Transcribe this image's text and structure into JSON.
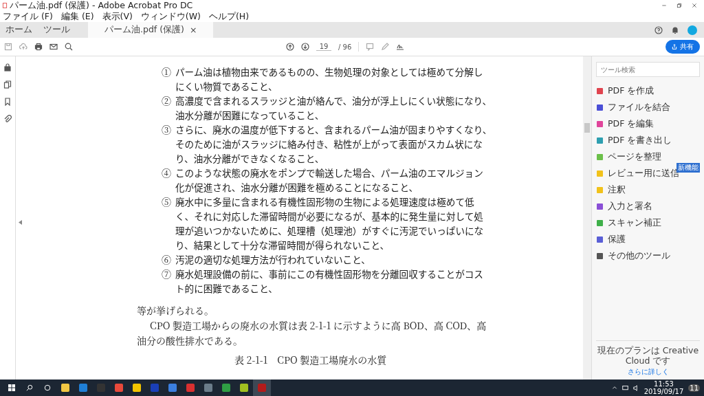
{
  "window": {
    "title": "パーム油.pdf (保護) - Adobe Acrobat Pro DC"
  },
  "menu": [
    "ファイル (F)",
    "編集 (E)",
    "表示(V)",
    "ウィンドウ(W)",
    "ヘルプ(H)"
  ],
  "tabs": [
    {
      "label": "ホーム",
      "selected": false
    },
    {
      "label": "ツール",
      "selected": false
    },
    {
      "label": "パーム油.pdf (保護)",
      "selected": true,
      "close": "×"
    }
  ],
  "toolbar": {
    "page": "19",
    "total": "/ 96",
    "share": "共有"
  },
  "document": {
    "items": [
      {
        "number": "①",
        "lines": [
          "パーム油は植物由来であるものの、生物処理の対象としては極めて分解し",
          "にくい物質であること、"
        ]
      },
      {
        "number": "②",
        "lines": [
          "高濃度で含まれるスラッジと油が絡んで、油分が浮上しにくい状態になり、",
          "油水分離が困難になっていること、"
        ]
      },
      {
        "number": "③",
        "lines": [
          "さらに、廃水の温度が低下すると、含まれるパーム油が固まりやすくなり、",
          "そのために油がスラッジに絡み付き、粘性が上がって表面がスカム状にな",
          "り、油水分離ができなくなること、"
        ]
      },
      {
        "number": "④",
        "lines": [
          "このような状態の廃水をポンプで輸送した場合、パーム油のエマルジョン",
          "化が促進され、油水分離が困難を極めることになること、"
        ]
      },
      {
        "number": "⑤",
        "lines": [
          "廃水中に多量に含まれる有機性固形物の生物による処理速度は極めて低",
          "く、それに対応した滞留時間が必要になるが、基本的に発生量に対して処",
          "理が追いつかないために、処理槽（処理池）がすぐに汚泥でいっぱいにな",
          "り、結果として十分な滞留時間が得られないこと、"
        ]
      },
      {
        "number": "⑥",
        "lines": [
          "汚泥の適切な処理方法が行われていないこと、"
        ]
      },
      {
        "number": "⑦",
        "lines": [
          "廃水処理設備の前に、事前にこの有機性固形物を分離回収することがコス",
          "ト的に困難であること、"
        ]
      }
    ],
    "closing": "等が挙げられる。",
    "paragraph": [
      "CPO 製造工場からの廃水の水質は表 2-1-1 に示すように高 BOD、高 COD、高",
      "油分の酸性排水である。"
    ],
    "caption": "表 2-1-1　CPO 製造工場廃水の水質"
  },
  "tools_panel": {
    "search": {
      "placeholder": "ツール検索"
    },
    "tools": [
      {
        "label": "PDF を作成",
        "color": "#e0444f"
      },
      {
        "label": "ファイルを結合",
        "color": "#4b4fd6"
      },
      {
        "label": "PDF を編集",
        "color": "#e0459b"
      },
      {
        "label": "PDF を書き出し",
        "color": "#2e9fb0"
      },
      {
        "label": "ページを整理",
        "color": "#6cc04a"
      },
      {
        "label": "レビュー用に送信",
        "color": "#f1c21b",
        "badge": "新機能"
      },
      {
        "label": "注釈",
        "color": "#f1c21b"
      },
      {
        "label": "入力と署名",
        "color": "#8a4fd6"
      },
      {
        "label": "スキャン補正",
        "color": "#3fb04a"
      },
      {
        "label": "保護",
        "color": "#5a5fd6"
      },
      {
        "label": "その他のツール",
        "color": "#555555"
      }
    ],
    "plan": "現在のプランは Creative Cloud です",
    "plan_link": "さらに詳しく"
  },
  "taskbar": {
    "apps": [
      {
        "color": "#f2c744",
        "selected": false
      },
      {
        "color": "#1f7fd6",
        "selected": false
      },
      {
        "color": "#333333",
        "selected": false
      },
      {
        "color": "#e8493b",
        "selected": false
      },
      {
        "color": "#f3c500",
        "selected": false
      },
      {
        "color": "#1a3fb8",
        "selected": false
      },
      {
        "color": "#3b7fe0",
        "selected": false
      },
      {
        "color": "#d93030",
        "selected": false
      },
      {
        "color": "#6b7c8a",
        "selected": false
      },
      {
        "color": "#2f9e44",
        "selected": false
      },
      {
        "color": "#a0c020",
        "selected": false
      },
      {
        "color": "#b31b1b",
        "selected": true
      }
    ],
    "time": "11:53",
    "date": "2019/09/17",
    "notifications": "11"
  }
}
